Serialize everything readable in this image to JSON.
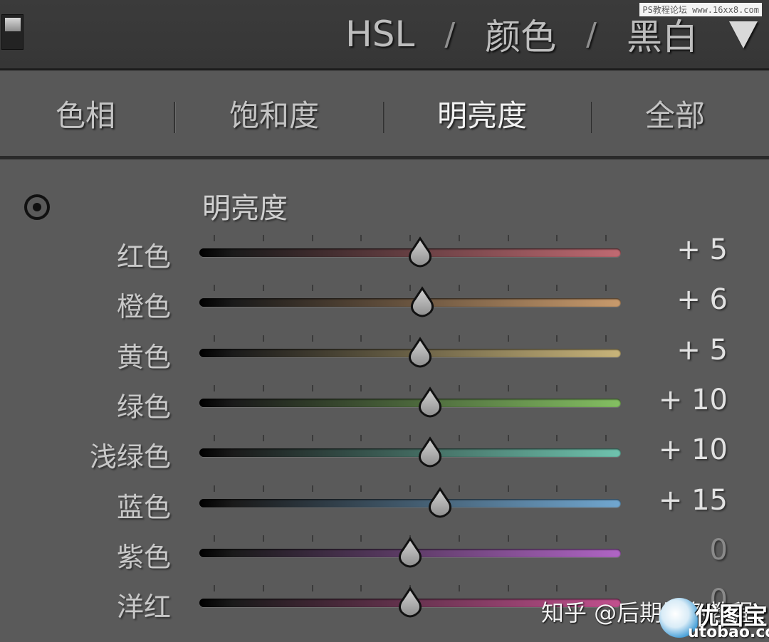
{
  "header": {
    "tabs": [
      "HSL",
      "颜色",
      "黑白"
    ],
    "separator": "/",
    "watermark": "PS教程论坛 www.16xx8.com"
  },
  "tabs": {
    "items": [
      "色相",
      "饱和度",
      "明亮度",
      "全部"
    ],
    "active": "明亮度"
  },
  "panel": {
    "title": "明亮度",
    "slider_range": [
      -100,
      100
    ],
    "sliders": [
      {
        "label": "红色",
        "value": 5,
        "display": "+ 5",
        "color": "#c06a72"
      },
      {
        "label": "橙色",
        "value": 6,
        "display": "+ 6",
        "color": "#c89a6c"
      },
      {
        "label": "黄色",
        "value": 5,
        "display": "+ 5",
        "color": "#c8b47a"
      },
      {
        "label": "绿色",
        "value": 10,
        "display": "+ 10",
        "color": "#84bf62"
      },
      {
        "label": "浅绿色",
        "value": 10,
        "display": "+ 10",
        "color": "#6fc3ae"
      },
      {
        "label": "蓝色",
        "value": 15,
        "display": "+ 15",
        "color": "#71a7d0"
      },
      {
        "label": "紫色",
        "value": 0,
        "display": "0",
        "color": "#b065c5"
      },
      {
        "label": "洋红",
        "value": 0,
        "display": "0",
        "color": "#c2508e"
      }
    ]
  },
  "watermarks": {
    "zhihu": "知乎 @后期调色教程",
    "logo_text": "优图宝",
    "logo_sub": "utobao.com"
  },
  "colors": {
    "panel_bg": "#5a5a5a",
    "header_bg": "#3b3b3b",
    "text": "#c8c8c8"
  }
}
